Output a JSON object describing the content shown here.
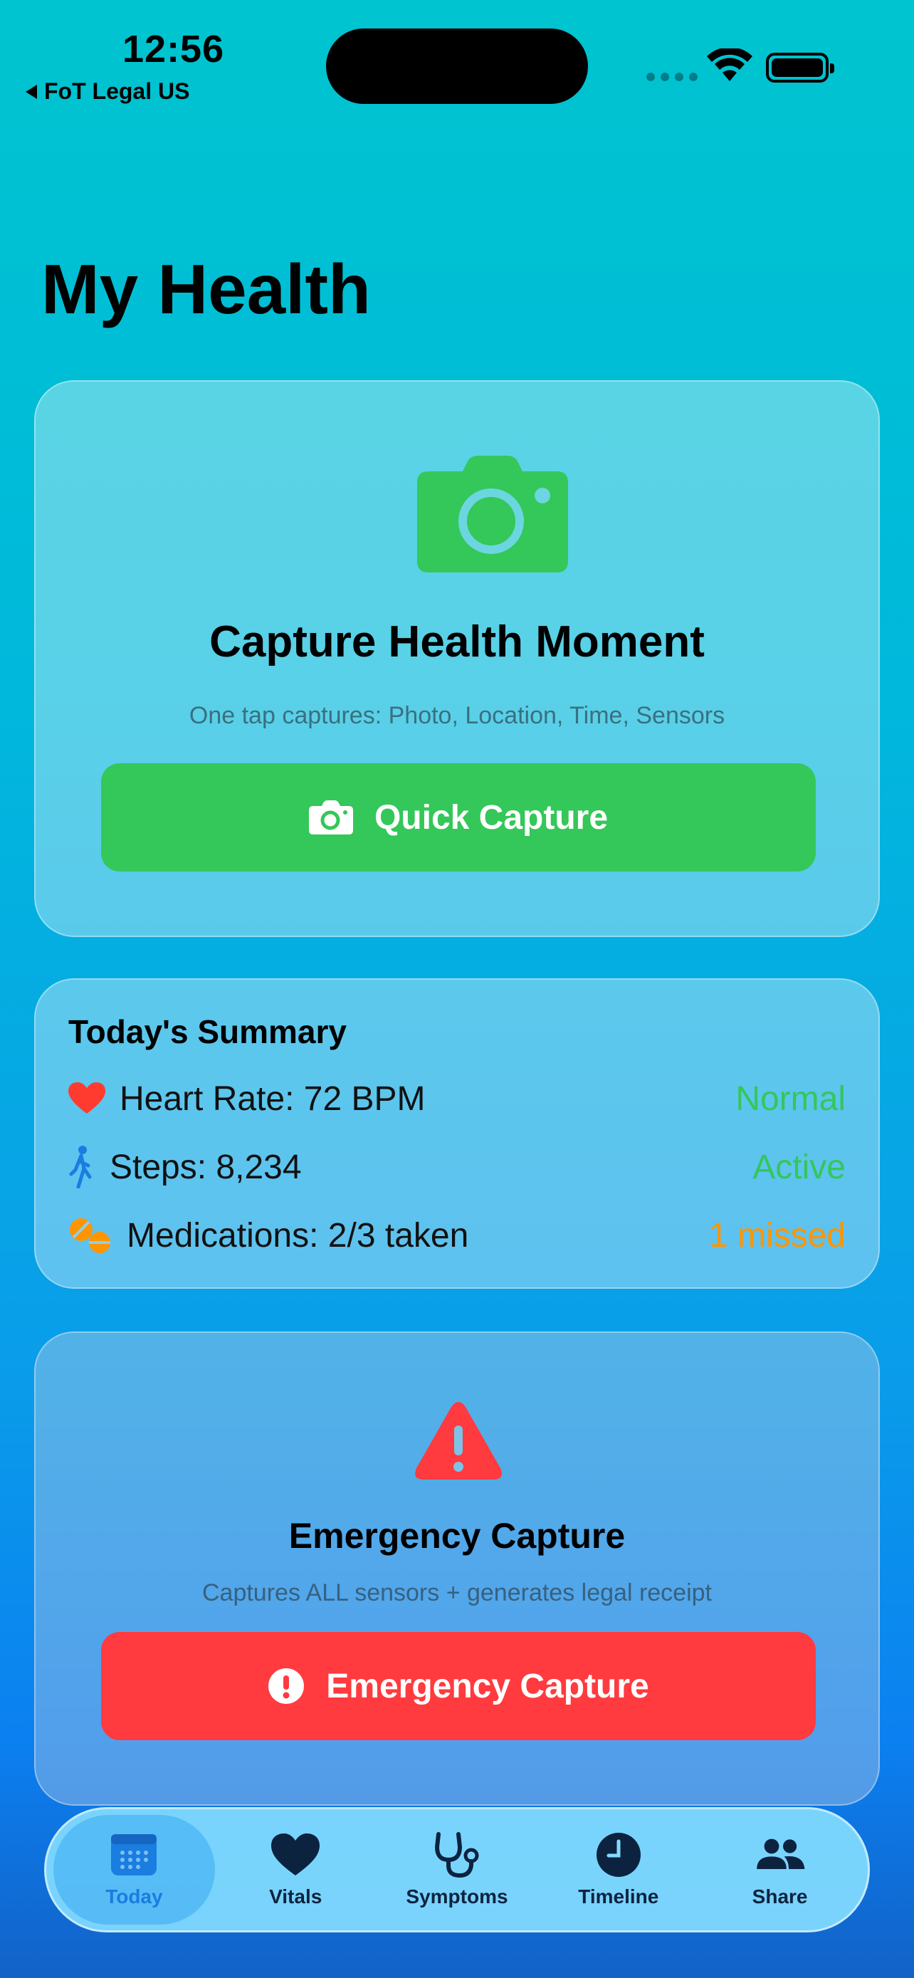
{
  "status_bar": {
    "time": "12:56",
    "back_label": "FoT Legal US"
  },
  "page": {
    "title": "My Health"
  },
  "capture_card": {
    "icon": "camera-icon",
    "title": "Capture Health Moment",
    "subtitle": "One tap captures: Photo, Location, Time, Sensors",
    "button_label": "Quick Capture",
    "accent_color": "#34c759"
  },
  "summary": {
    "title": "Today's Summary",
    "rows": [
      {
        "icon": "heart-icon",
        "label": "Heart Rate: 72 BPM",
        "status": "Normal",
        "status_color": "#34c759"
      },
      {
        "icon": "walking-icon",
        "label": "Steps: 8,234",
        "status": "Active",
        "status_color": "#34c759"
      },
      {
        "icon": "pills-icon",
        "label": "Medications: 2/3 taken",
        "status": "1 missed",
        "status_color": "#ff9500"
      }
    ]
  },
  "emergency_card": {
    "icon": "warning-triangle-icon",
    "title": "Emergency Capture",
    "subtitle": "Captures ALL sensors + generates legal receipt",
    "button_label": "Emergency Capture",
    "accent_color": "#ff3b3f"
  },
  "tab_bar": {
    "tabs": [
      {
        "label": "Today",
        "icon": "calendar-icon",
        "active": true
      },
      {
        "label": "Vitals",
        "icon": "heart-icon",
        "active": false
      },
      {
        "label": "Symptoms",
        "icon": "stethoscope-icon",
        "active": false
      },
      {
        "label": "Timeline",
        "icon": "clock-icon",
        "active": false
      },
      {
        "label": "Share",
        "icon": "people-icon",
        "active": false
      }
    ]
  }
}
